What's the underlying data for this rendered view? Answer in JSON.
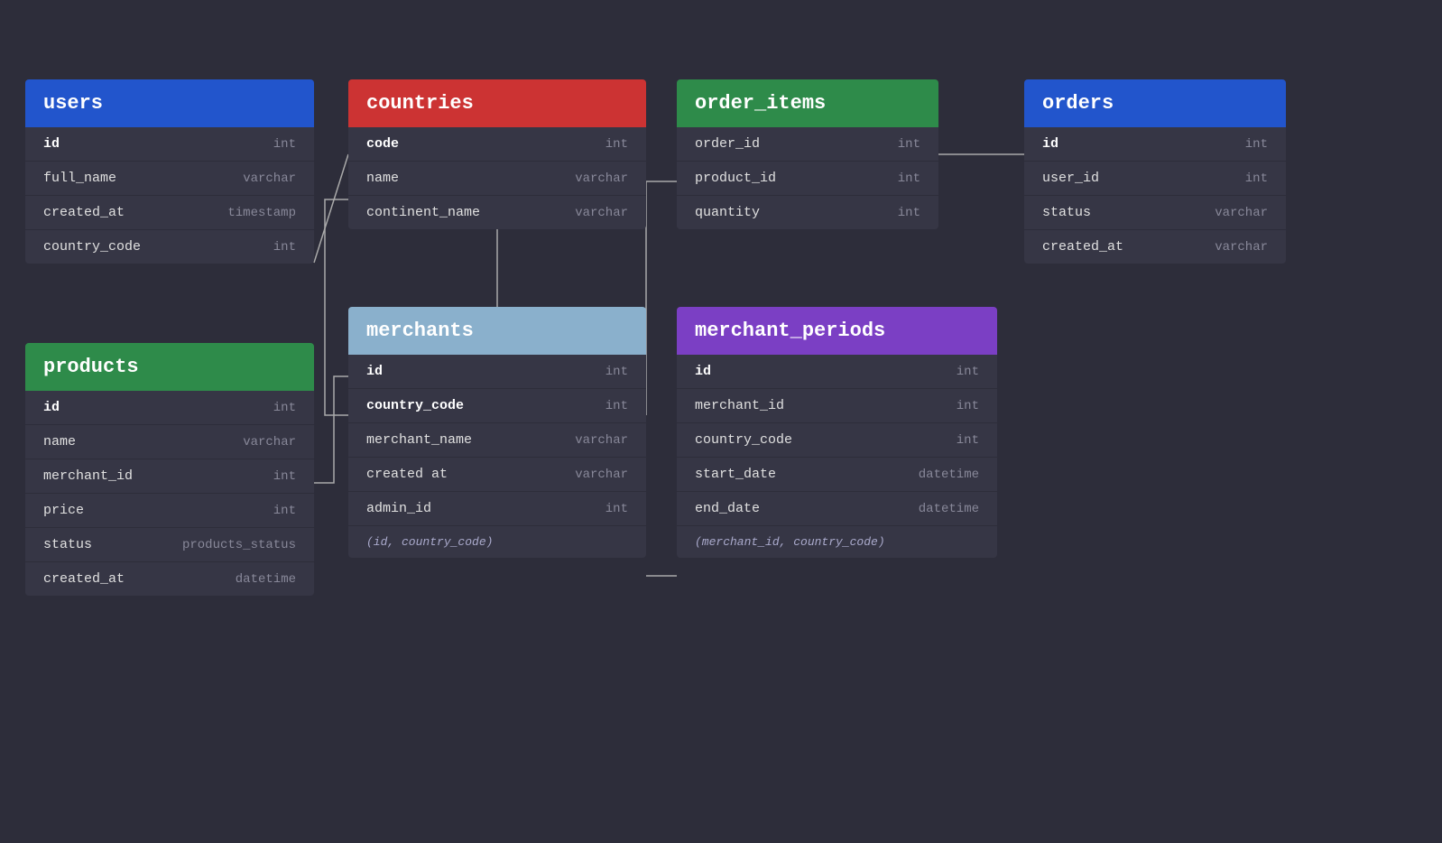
{
  "tables": {
    "users": {
      "name": "users",
      "headerClass": "header-blue",
      "fields": [
        {
          "name": "id",
          "type": "int",
          "bold": true
        },
        {
          "name": "full_name",
          "type": "varchar"
        },
        {
          "name": "created_at",
          "type": "timestamp"
        },
        {
          "name": "country_code",
          "type": "int"
        }
      ]
    },
    "countries": {
      "name": "countries",
      "headerClass": "header-red",
      "fields": [
        {
          "name": "code",
          "type": "int",
          "bold": true
        },
        {
          "name": "name",
          "type": "varchar"
        },
        {
          "name": "continent_name",
          "type": "varchar"
        }
      ]
    },
    "order_items": {
      "name": "order_items",
      "headerClass": "header-green",
      "fields": [
        {
          "name": "order_id",
          "type": "int"
        },
        {
          "name": "product_id",
          "type": "int"
        },
        {
          "name": "quantity",
          "type": "int"
        }
      ]
    },
    "orders": {
      "name": "orders",
      "headerClass": "header-blue",
      "fields": [
        {
          "name": "id",
          "type": "int",
          "bold": true
        },
        {
          "name": "user_id",
          "type": "int"
        },
        {
          "name": "status",
          "type": "varchar"
        },
        {
          "name": "created_at",
          "type": "varchar"
        }
      ]
    },
    "merchants": {
      "name": "merchants",
      "headerClass": "header-light-blue",
      "fields": [
        {
          "name": "id",
          "type": "int",
          "bold": true
        },
        {
          "name": "country_code",
          "type": "int",
          "bold": true
        },
        {
          "name": "merchant_name",
          "type": "varchar"
        },
        {
          "name": "created at",
          "type": "varchar"
        },
        {
          "name": "admin_id",
          "type": "int"
        },
        {
          "name": "(id, country_code)",
          "type": "",
          "composite": true
        }
      ]
    },
    "merchant_periods": {
      "name": "merchant_periods",
      "headerClass": "header-purple",
      "fields": [
        {
          "name": "id",
          "type": "int",
          "bold": true
        },
        {
          "name": "merchant_id",
          "type": "int"
        },
        {
          "name": "country_code",
          "type": "int"
        },
        {
          "name": "start_date",
          "type": "datetime"
        },
        {
          "name": "end_date",
          "type": "datetime"
        },
        {
          "name": "(merchant_id, country_code)",
          "type": "",
          "composite": true
        }
      ]
    },
    "products": {
      "name": "products",
      "headerClass": "header-green",
      "fields": [
        {
          "name": "id",
          "type": "int",
          "bold": true
        },
        {
          "name": "name",
          "type": "varchar"
        },
        {
          "name": "merchant_id",
          "type": "int"
        },
        {
          "name": "price",
          "type": "int"
        },
        {
          "name": "status",
          "type": "products_status"
        },
        {
          "name": "created_at",
          "type": "datetime"
        }
      ]
    }
  }
}
